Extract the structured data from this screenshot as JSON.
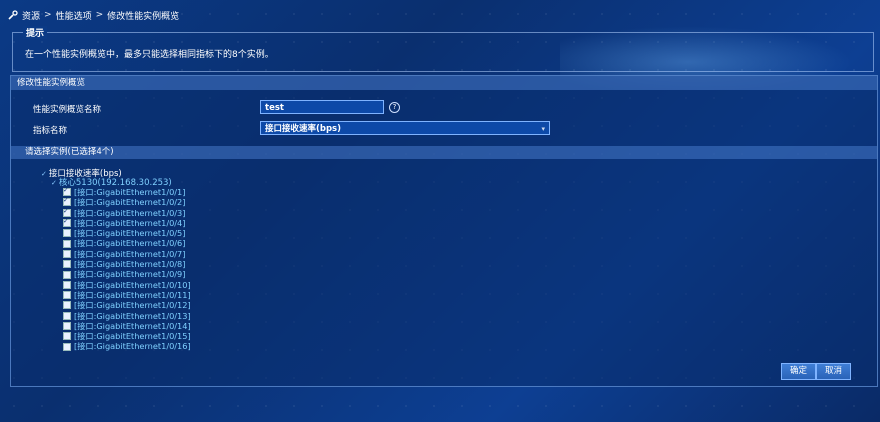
{
  "breadcrumb": {
    "items": [
      "资源",
      "性能选项",
      "修改性能实例概览"
    ],
    "separator": ">"
  },
  "tip": {
    "legend": "提示",
    "text": "在一个性能实例概览中，最多只能选择相同指标下的8个实例。"
  },
  "panel": {
    "title": "修改性能实例概览",
    "name_label": "性能实例概览名称",
    "name_value": "test",
    "metric_label": "指标名称",
    "metric_value": "接口接收速率(bps)"
  },
  "instances": {
    "header": "请选择实例(已选择4个)",
    "root_label": "接口接收速率(bps)",
    "device_label": "核心5130(192.168.30.253)",
    "items": [
      {
        "label": "[接口:GigabitEthernet1/0/1]",
        "checked": true
      },
      {
        "label": "[接口:GigabitEthernet1/0/2]",
        "checked": true
      },
      {
        "label": "[接口:GigabitEthernet1/0/3]",
        "checked": true
      },
      {
        "label": "[接口:GigabitEthernet1/0/4]",
        "checked": true
      },
      {
        "label": "[接口:GigabitEthernet1/0/5]",
        "checked": false
      },
      {
        "label": "[接口:GigabitEthernet1/0/6]",
        "checked": false
      },
      {
        "label": "[接口:GigabitEthernet1/0/7]",
        "checked": false
      },
      {
        "label": "[接口:GigabitEthernet1/0/8]",
        "checked": false
      },
      {
        "label": "[接口:GigabitEthernet1/0/9]",
        "checked": false
      },
      {
        "label": "[接口:GigabitEthernet1/0/10]",
        "checked": false
      },
      {
        "label": "[接口:GigabitEthernet1/0/11]",
        "checked": false
      },
      {
        "label": "[接口:GigabitEthernet1/0/12]",
        "checked": false
      },
      {
        "label": "[接口:GigabitEthernet1/0/13]",
        "checked": false
      },
      {
        "label": "[接口:GigabitEthernet1/0/14]",
        "checked": false
      },
      {
        "label": "[接口:GigabitEthernet1/0/15]",
        "checked": false
      },
      {
        "label": "[接口:GigabitEthernet1/0/16]",
        "checked": false
      }
    ]
  },
  "buttons": {
    "ok": "确定",
    "cancel": "取消"
  },
  "icons": {
    "breadcrumb": "wrench-icon",
    "help": "help-icon",
    "dropdown": "chevron-down-icon"
  }
}
